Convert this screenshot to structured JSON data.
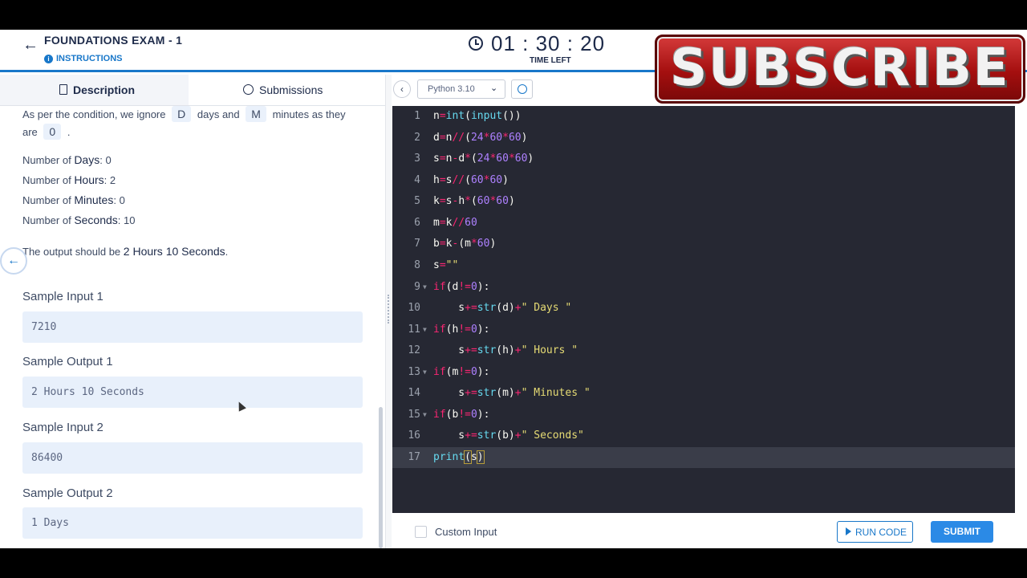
{
  "header": {
    "back_icon": "arrow-left-icon",
    "exam_title": "FOUNDATIONS EXAM - 1",
    "instructions": "INSTRUCTIONS",
    "timer": "01 : 30 : 20",
    "time_left": "TIME LEFT",
    "accent_color": "#1877c9"
  },
  "subscribe_banner": {
    "text": "SUBSCRIBE"
  },
  "tabs": [
    {
      "label": "Description",
      "icon": "document-icon",
      "active": true
    },
    {
      "label": "Submissions",
      "icon": "history-icon",
      "active": false
    }
  ],
  "description": {
    "condition": {
      "prefix": "As per the condition, we ignore",
      "chip1": "D",
      "mid": "days and",
      "chip2": "M",
      "suffix": "minutes as they",
      "line2_prefix": "are",
      "chip3": "0",
      "line2_suffix": "."
    },
    "stats": [
      {
        "prefix": "Number of ",
        "key": "Days",
        "value": ": 0"
      },
      {
        "prefix": "Number of ",
        "key": "Hours",
        "value": ": 2"
      },
      {
        "prefix": "Number of ",
        "key": "Minutes",
        "value": ": 0"
      },
      {
        "prefix": "Number of ",
        "key": "Seconds",
        "value": ": 10"
      }
    ],
    "output_prefix": "The output should be",
    "output_value": "2 Hours 10 Seconds",
    "output_suffix": ".",
    "samples": [
      {
        "title": "Sample Input 1",
        "value": "7210"
      },
      {
        "title": "Sample Output 1",
        "value": "2 Hours 10 Seconds"
      },
      {
        "title": "Sample Input 2",
        "value": "86400"
      },
      {
        "title": "Sample Output 2",
        "value": "1 Days"
      }
    ]
  },
  "editor": {
    "language": "Python 3.10",
    "active_line": 17,
    "lines": [
      "n=int(input())",
      "d=n//(24*60*60)",
      "s=n-d*(24*60*60)",
      "h=s//(60*60)",
      "k=s-h*(60*60)",
      "m=k//60",
      "b=k-(m*60)",
      "s=\"\"",
      "if(d!=0):",
      "    s+=str(d)+\" Days \"",
      "if(h!=0):",
      "    s+=str(h)+\" Hours \"",
      "if(m!=0):",
      "    s+=str(m)+\" Minutes \"",
      "if(b!=0):",
      "    s+=str(b)+\" Seconds\"",
      "print(s)"
    ],
    "line_numbers": [
      "1",
      "2",
      "3",
      "4",
      "5",
      "6",
      "7",
      "8",
      "9",
      "10",
      "11",
      "12",
      "13",
      "14",
      "15",
      "16",
      "17"
    ]
  },
  "bottom": {
    "custom_input": "Custom Input",
    "run_code": "RUN CODE",
    "submit": "SUBMIT"
  }
}
